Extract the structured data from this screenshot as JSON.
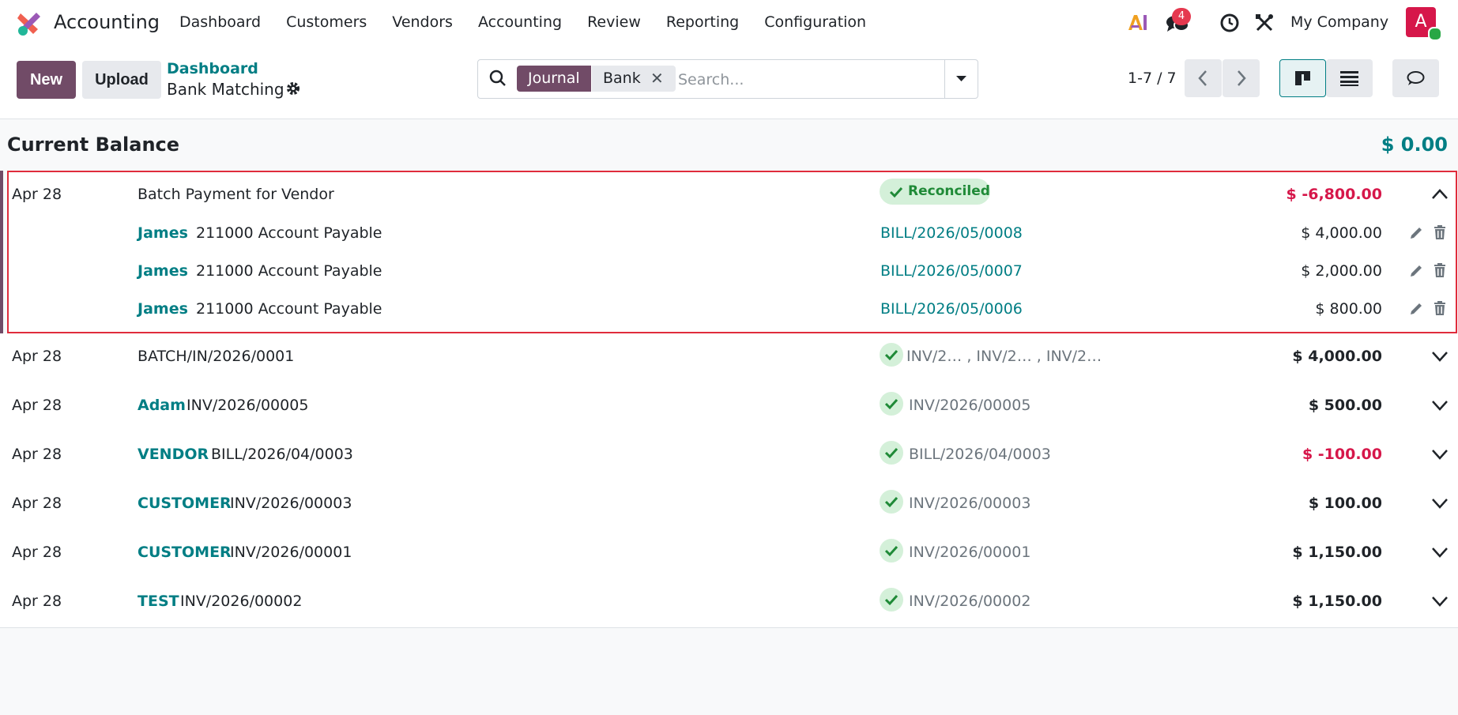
{
  "app": {
    "name": "Accounting"
  },
  "menu": [
    "Dashboard",
    "Customers",
    "Vendors",
    "Accounting",
    "Review",
    "Reporting",
    "Configuration"
  ],
  "topbar": {
    "chat_badge": "4",
    "company": "My Company",
    "avatar_letter": "A"
  },
  "control": {
    "new_label": "New",
    "upload_label": "Upload",
    "breadcrumb_parent": "Dashboard",
    "breadcrumb_current": "Bank Matching"
  },
  "search": {
    "facet_label": "Journal",
    "facet_value": "Bank",
    "placeholder": "Search..."
  },
  "pager": {
    "value": "1-7 / 7"
  },
  "balance": {
    "label": "Current Balance",
    "value": "$ 0.00"
  },
  "expanded": {
    "date": "Apr 28",
    "label": "Batch Payment for Vendor",
    "status": "Reconciled",
    "amount": "$ -6,800.00",
    "lines": [
      {
        "partner": "James",
        "account": "211000 Account Payable",
        "ref": "BILL/2026/05/0008",
        "amount": "$ 4,000.00"
      },
      {
        "partner": "James",
        "account": "211000 Account Payable",
        "ref": "BILL/2026/05/0007",
        "amount": "$ 2,000.00"
      },
      {
        "partner": "James",
        "account": "211000 Account Payable",
        "ref": "BILL/2026/05/0006",
        "amount": "$ 800.00"
      }
    ]
  },
  "rows": [
    {
      "date": "Apr 28",
      "partner": "",
      "label": "BATCH/IN/2026/0001",
      "matched": "INV/2…   , INV/2…   , INV/2…",
      "amount": "$ 4,000.00",
      "negative": false
    },
    {
      "date": "Apr 28",
      "partner": "Adam",
      "label": "INV/2026/00005",
      "matched": "INV/2026/00005",
      "amount": "$ 500.00",
      "negative": false
    },
    {
      "date": "Apr 28",
      "partner": "VENDOR",
      "label": "BILL/2026/04/0003",
      "matched": "BILL/2026/04/0003",
      "amount": "$ -100.00",
      "negative": true
    },
    {
      "date": "Apr 28",
      "partner": "CUSTOMER",
      "label": "INV/2026/00003",
      "matched": "INV/2026/00003",
      "amount": "$ 100.00",
      "negative": false
    },
    {
      "date": "Apr 28",
      "partner": "CUSTOMER",
      "label": "INV/2026/00001",
      "matched": "INV/2026/00001",
      "amount": "$ 1,150.00",
      "negative": false
    },
    {
      "date": "Apr 28",
      "partner": "TEST",
      "label": "INV/2026/00002",
      "matched": "INV/2026/00002",
      "amount": "$ 1,150.00",
      "negative": false
    }
  ],
  "colors": {
    "brand": "#714b67",
    "teal": "#017e84",
    "negative": "#d6174a",
    "reconciled_bg": "#d4f0d9",
    "reconciled_fg": "#1f8a37"
  }
}
